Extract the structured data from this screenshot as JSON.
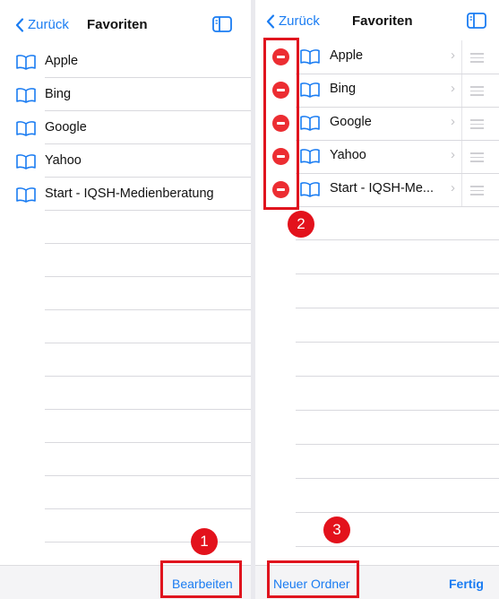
{
  "left": {
    "nav": {
      "back_label": "Zurück",
      "title": "Favoriten"
    },
    "items": [
      {
        "label": "Apple"
      },
      {
        "label": "Bing"
      },
      {
        "label": "Google"
      },
      {
        "label": "Yahoo"
      },
      {
        "label": "Start - IQSH-Medienberatung"
      }
    ],
    "toolbar": {
      "edit_label": "Bearbeiten"
    }
  },
  "right": {
    "nav": {
      "back_label": "Zurück",
      "title": "Favoriten"
    },
    "items": [
      {
        "label": "Apple"
      },
      {
        "label": "Bing"
      },
      {
        "label": "Google"
      },
      {
        "label": "Yahoo"
      },
      {
        "label": "Start - IQSH-Me..."
      }
    ],
    "toolbar": {
      "new_folder_label": "Neuer Ordner",
      "done_label": "Fertig"
    }
  },
  "annotations": {
    "badge_1": "1",
    "badge_2": "2",
    "badge_3": "3"
  },
  "colors": {
    "accent": "#1a7cf2",
    "delete": "#ec2d32",
    "annotation": "#e0141e"
  },
  "icons": {
    "back": "chevron-left-icon",
    "sidebar": "sidebar-icon",
    "bookmark": "book-icon",
    "delete": "minus-circle-icon",
    "reorder": "reorder-grip-icon",
    "disclosure": "chevron-right-icon"
  }
}
